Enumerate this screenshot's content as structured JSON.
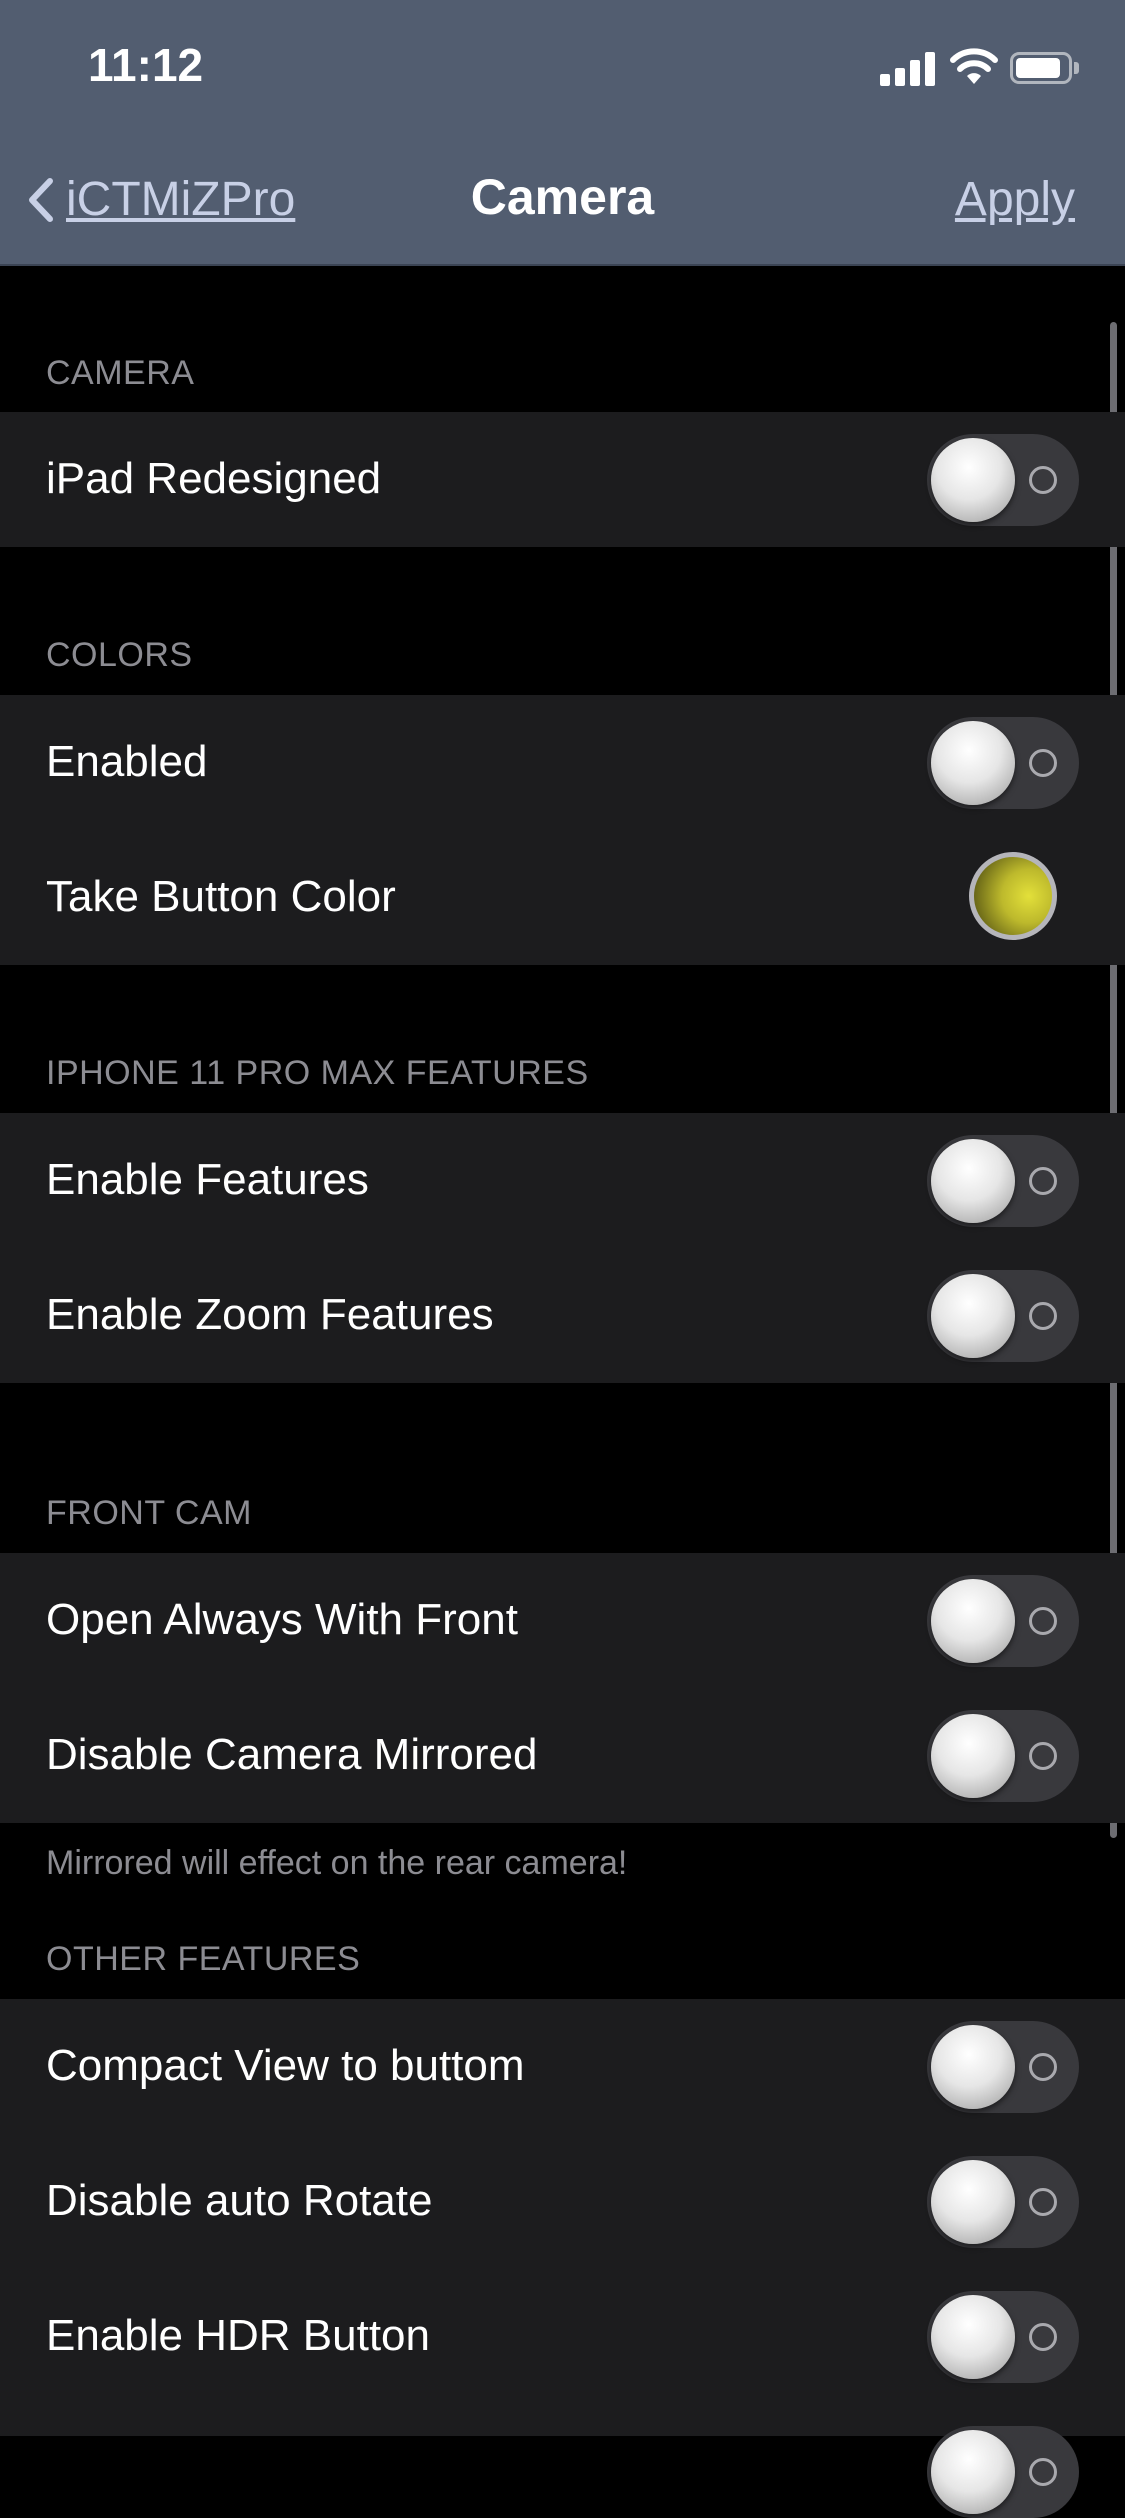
{
  "status_bar": {
    "time": "11:12"
  },
  "nav": {
    "back_label": "iCTMiZPro",
    "title": "Camera",
    "apply_label": "Apply"
  },
  "sections": {
    "camera": {
      "header": "CAMERA",
      "rows": [
        "iPad Redesigned"
      ]
    },
    "colors": {
      "header": "COLORS",
      "rows": [
        "Enabled",
        "Take Button Color"
      ]
    },
    "iphone": {
      "header": "IPHONE 11 PRO MAX FEATURES",
      "rows": [
        "Enable Features",
        "Enable Zoom Features"
      ]
    },
    "front": {
      "header": "FRONT CAM",
      "rows": [
        "Open Always With Front",
        "Disable Camera Mirrored"
      ],
      "footer": "Mirrored will effect on the rear camera!"
    },
    "other": {
      "header": "OTHER FEATURES",
      "rows": [
        "Compact View to buttom",
        "Disable auto Rotate",
        "Enable HDR Button"
      ]
    }
  },
  "toggles_state": "off",
  "colors": {
    "take_button_color": "#d6d334",
    "nav_background": "#525d70"
  }
}
